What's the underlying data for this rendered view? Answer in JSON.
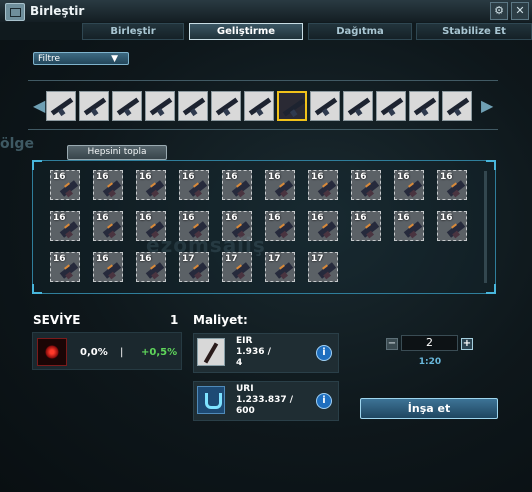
{
  "window": {
    "title": "Birleştir"
  },
  "tabs": [
    {
      "label": "Birleştir",
      "active": false
    },
    {
      "label": "Geliştirme",
      "active": true
    },
    {
      "label": "Dağıtma",
      "active": false
    },
    {
      "label": "Stabilize Et",
      "active": false
    }
  ],
  "filter": {
    "label": "Filtre"
  },
  "carousel": {
    "items": [
      "weapon-1",
      "weapon-2",
      "weapon-3",
      "weapon-4",
      "weapon-5",
      "weapon-6",
      "weapon-7",
      "weapon-8",
      "weapon-9",
      "weapon-10",
      "weapon-11",
      "weapon-12",
      "weapon-13"
    ],
    "selected_index": 7
  },
  "ghost_label": "ölge",
  "collect_all": "Hepsini topla",
  "grid": {
    "levels": [
      "16",
      "16",
      "16",
      "16",
      "16",
      "16",
      "16",
      "16",
      "16",
      "16",
      "16",
      "16",
      "16",
      "16",
      "16",
      "16",
      "16",
      "16",
      "16",
      "16",
      "16",
      "16",
      "16",
      "17",
      "17",
      "17",
      "17"
    ]
  },
  "watermark": "ezomsaiiş",
  "level": {
    "label": "SEVİYE",
    "value": "1",
    "current": "0,0%",
    "separator": "|",
    "gain": "+0,5%"
  },
  "cost": {
    "label": "Maliyet:",
    "resources": [
      {
        "name": "EIR",
        "have": "1.936 /",
        "need": "4"
      },
      {
        "name": "URI",
        "have": "1.233.837 /",
        "need": "600"
      }
    ]
  },
  "stepper": {
    "value": "2",
    "minus": "−",
    "plus": "+",
    "time": "1:20"
  },
  "build_button": "İnşa et",
  "colors": {
    "accent": "#48b6dc",
    "gain": "#5fd65b",
    "selected": "#f1c21a"
  }
}
